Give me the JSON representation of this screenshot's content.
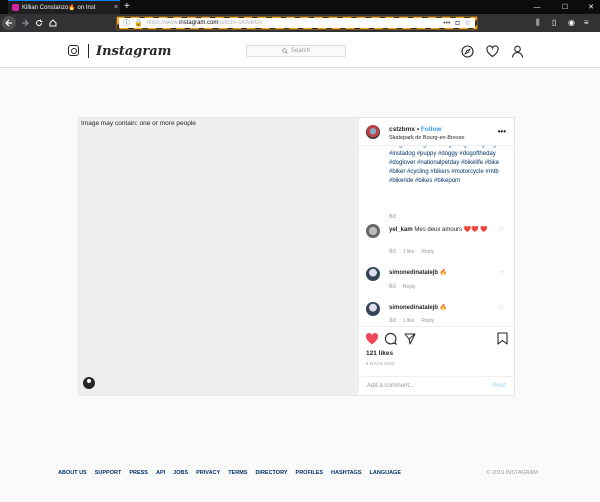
{
  "browser": {
    "tab_title": "Killian Constanzo🔥 on Inst",
    "tab_close": "×",
    "new_tab": "+",
    "url_prefix": "https://www.",
    "url_host": "instagram.com",
    "url_path": "/p/B3A-sKAlBGi/",
    "window_controls": [
      "—",
      "☐",
      "✕"
    ],
    "nav_icons": [
      "back-arrow",
      "forward-arrow",
      "reload",
      "home"
    ]
  },
  "ig": {
    "logo": "Instagram",
    "search_placeholder": "Search",
    "header_icons": [
      "compass-icon",
      "heart-icon",
      "profile-icon"
    ]
  },
  "post": {
    "image_alt": "Image may contain: one or more people",
    "username": "cstzbmx",
    "separator": " • ",
    "follow": "Follow",
    "location": "Skatepark de Bourg-en-Bresse",
    "more": "•••",
    "hashtags": "#dogsofinstagram #dog #dogs #dogstagram #instadog #puppy #doggy #dogoftheday #doglover #nationalpetday #bikelife #bike #biker #cycling #bikers #motorcycle #mtb #bikeride #bikes #bikeporn",
    "hashtags_top_partial": "#dogsofinstagram #dog #dogs",
    "caption_age": "6d",
    "comments": [
      {
        "name": "yel_kam",
        "text": "Mes deux amours ❤️❤️ ❤️",
        "age": "6d",
        "likes": "1 like",
        "reply": "Reply"
      },
      {
        "name": "simonedinatalejb",
        "text": "🔥",
        "age": "6d",
        "likes": "",
        "reply": "Reply"
      },
      {
        "name": "simonedinatalejb",
        "text": "🔥",
        "age": "3d",
        "likes": "1 like",
        "reply": "Reply"
      }
    ],
    "likes": "121 likes",
    "time_ago": "6 DAYS AGO",
    "add_comment_placeholder": "Add a comment...",
    "post_button": "Post"
  },
  "footer": {
    "links": [
      "ABOUT US",
      "SUPPORT",
      "PRESS",
      "API",
      "JOBS",
      "PRIVACY",
      "TERMS",
      "DIRECTORY",
      "PROFILES",
      "HASHTAGS",
      "LANGUAGE"
    ],
    "copyright": "© 2019 INSTAGRAM"
  },
  "colors": {
    "accent_blue": "#3897f0",
    "like_red": "#ed4956",
    "hashtag": "#003569"
  }
}
